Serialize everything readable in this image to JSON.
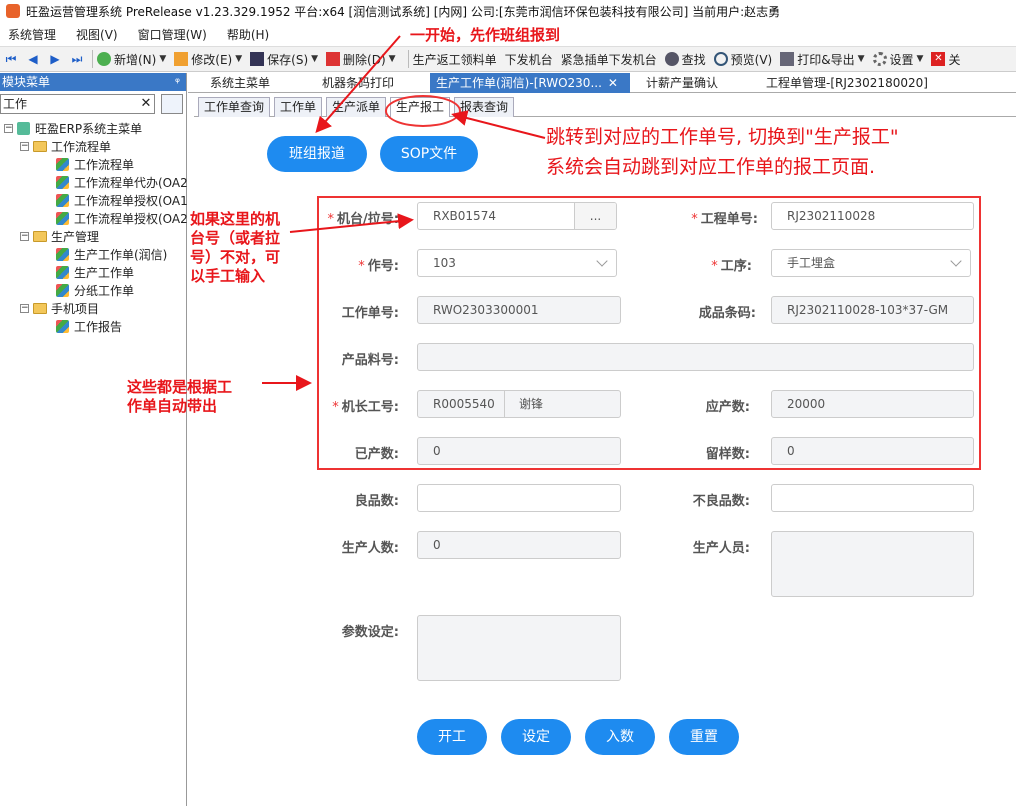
{
  "window": {
    "title": "旺盈运营管理系统 PreRelease v1.23.329.1952 平台:x64 [润信测试系统] [内网] 公司:[东莞市润信环保包装科技有限公司] 当前用户:赵志勇"
  },
  "menu": [
    "系统管理",
    "视图(V)",
    "窗口管理(W)",
    "帮助(H)"
  ],
  "toolbar": {
    "new": "新增(N)",
    "edit": "修改(E)",
    "save": "保存(S)",
    "delete": "删除(D)",
    "return_pick": "生产返工领料单",
    "dispatch": "下发机台",
    "urgent": "紧急插单下发机台",
    "find": "查找",
    "preview": "预览(V)",
    "print": "打印&导出",
    "settings": "设置",
    "close": "关"
  },
  "left_panel": {
    "header": "模块菜单",
    "pin": "ᵠ",
    "search_value": "工作",
    "tree": {
      "root": "旺盈ERP系统主菜单",
      "g1": "工作流程单",
      "g1_items": [
        "工作流程单",
        "工作流程单代办(OA2",
        "工作流程单授权(OA1",
        "工作流程单授权(OA2"
      ],
      "g2": "生产管理",
      "g2_items": [
        "生产工作单(润信)",
        "生产工作单",
        "分纸工作单"
      ],
      "g3": "手机项目",
      "g3_items": [
        "工作报告"
      ]
    }
  },
  "tabs_main": [
    "系统主菜单",
    "机器条码打印",
    "生产工作单(润信)-[RWO230...",
    "计薪产量确认",
    "工程单管理-[RJ2302180020]"
  ],
  "tabs_sub": [
    "工作单查询",
    "工作单",
    "生产派单",
    "生产报工",
    "报表查询"
  ],
  "top_buttons": {
    "team_report": "班组报道",
    "sop": "SOP文件"
  },
  "form": {
    "machine_label": "机台/拉号:",
    "machine_value": "RXB01574",
    "machine_btn": "...",
    "project_label": "工程单号:",
    "project_value": "RJ2302110028",
    "work_label": "作号:",
    "work_value": "103",
    "process_label": "工序:",
    "process_value": "手工埋盒",
    "order_label": "工作单号:",
    "order_value": "RWO2303300001",
    "barcode_label": "成品条码:",
    "barcode_value": "RJ2302110028-103*37-GM",
    "material_label": "产品料号:",
    "material_value": "",
    "captain_label": "机长工号:",
    "captain_id": "R0005540",
    "captain_name": "谢锋",
    "planned_label": "应产数:",
    "planned_value": "20000",
    "produced_label": "已产数:",
    "produced_value": "0",
    "sample_label": "留样数:",
    "sample_value": "0",
    "good_label": "良品数:",
    "good_value": "",
    "bad_label": "不良品数:",
    "bad_value": "",
    "workers_label": "生产人数:",
    "workers_value": "0",
    "staff_label": "生产人员:",
    "staff_value": "",
    "params_label": "参数设定:",
    "params_value": ""
  },
  "bottom_buttons": {
    "start": "开工",
    "set": "设定",
    "stock_in": "入数",
    "reset": "重置"
  },
  "annotations": {
    "top": "一开始，先作班组报到",
    "right_line1": "跳转到对应的工作单号, 切换到\"生产报工\"",
    "right_line2": "系统会自动跳到对应工作单的报工页面.",
    "left_mid_1": "如果这里的机",
    "left_mid_2": "台号（或者拉",
    "left_mid_3": "号）不对，可",
    "left_mid_4": "以手工输入",
    "left_low_1": "这些都是根据工",
    "left_low_2": "作单自动带出"
  },
  "colors": {
    "accent": "#1e8bf0",
    "annotation": "#e8161b",
    "header_blue": "#3a78c6"
  }
}
